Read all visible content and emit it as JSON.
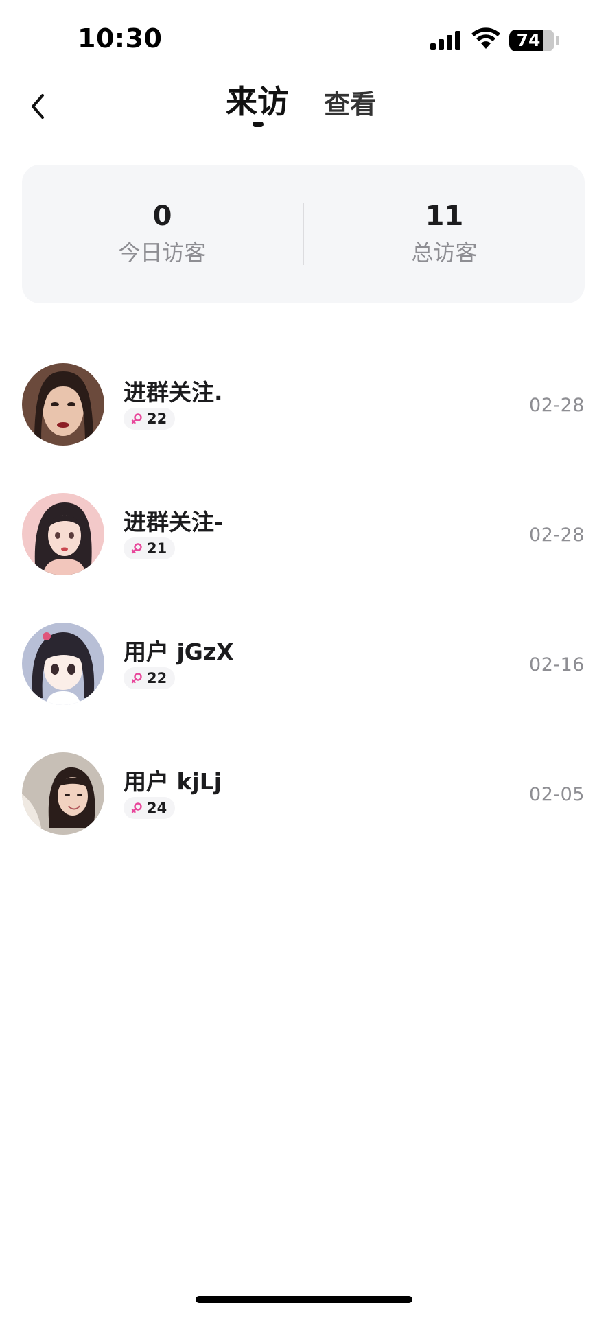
{
  "status_bar": {
    "time": "10:30",
    "battery": "74",
    "battery_level": 0.74,
    "icons": [
      "signal-icon",
      "wifi-icon",
      "battery-icon"
    ]
  },
  "header": {
    "back_icon": "chevron-left-icon",
    "tabs": [
      {
        "label": "来访",
        "active": true
      },
      {
        "label": "查看",
        "active": false
      }
    ]
  },
  "stats": {
    "today": {
      "value": "0",
      "label": "今日访客"
    },
    "total": {
      "value": "11",
      "label": "总访客"
    }
  },
  "visitors": [
    {
      "name": "进群关注.",
      "badge_value": "22",
      "date": "02-28",
      "avatar_bg": "#6b4a3c"
    },
    {
      "name": "进群关注-",
      "badge_value": "21",
      "date": "02-28",
      "avatar_bg": "#f3c9c9"
    },
    {
      "name": "用户 jGzX",
      "badge_value": "22",
      "date": "02-16",
      "avatar_bg": "#b8bfd6"
    },
    {
      "name": "用户 kjLj",
      "badge_value": "24",
      "date": "02-05",
      "avatar_bg": "#c7bfb6"
    }
  ],
  "colors": {
    "badge_icon": "#e8479b",
    "card_bg": "#f5f6f8",
    "secondary_text": "#8e8e93"
  }
}
